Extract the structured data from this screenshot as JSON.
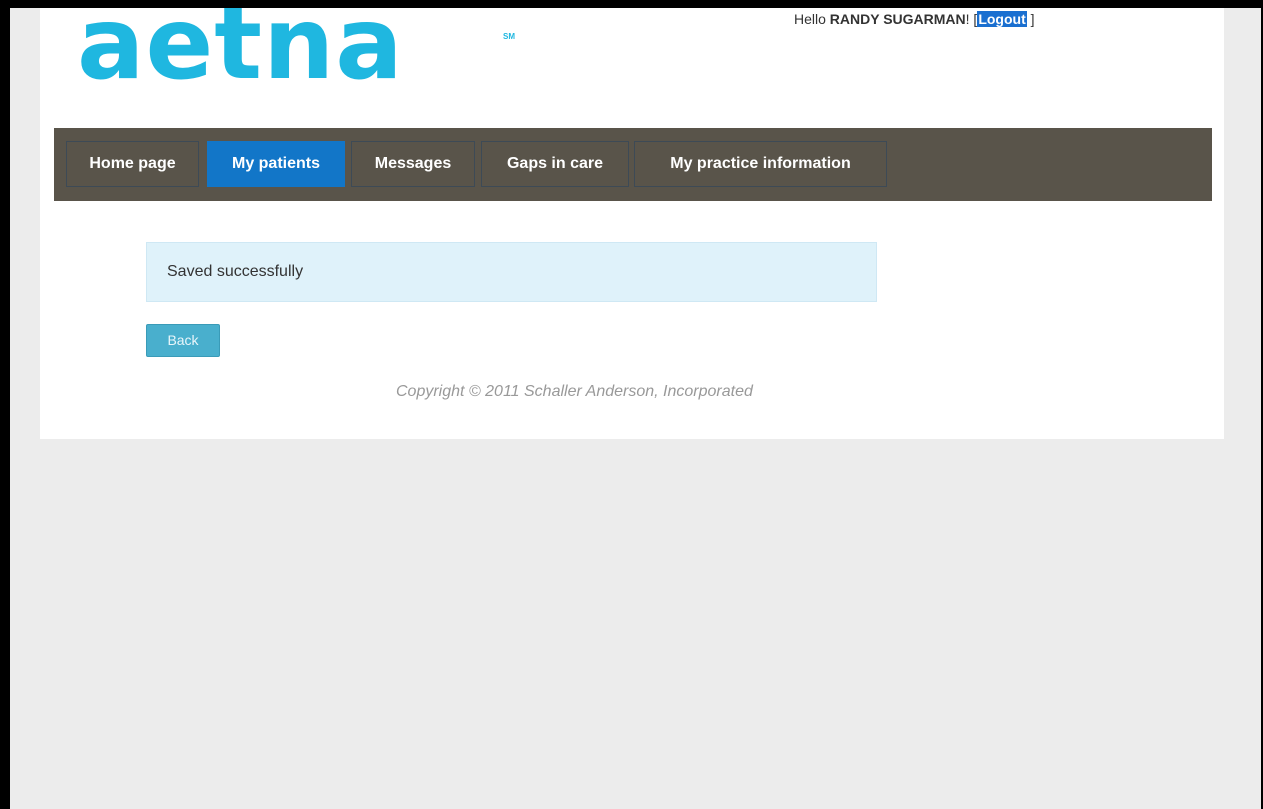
{
  "header": {
    "logo_text": "aetna",
    "logo_mark": "SM",
    "greeting_prefix": "Hello ",
    "user_name": "RANDY SUGARMAN",
    "greeting_suffix": "! [",
    "logout_label": "Logout",
    "logout_close": " ]"
  },
  "nav": {
    "items": [
      {
        "label": "Home page"
      },
      {
        "label": "My patients"
      },
      {
        "label": "Messages"
      },
      {
        "label": "Gaps in care"
      },
      {
        "label": "My practice information"
      }
    ],
    "active": "My patients"
  },
  "main": {
    "alert_text": "Saved successfully",
    "back_label": "Back"
  },
  "footer": {
    "copyright": "Copyright © 2011 Schaller Anderson, Incorporated"
  },
  "colors": {
    "brand": "#1fb7e0",
    "nav_background": "#59544a",
    "nav_active": "#1276c8",
    "alert_background": "#dff2fa",
    "button": "#49afcd"
  }
}
